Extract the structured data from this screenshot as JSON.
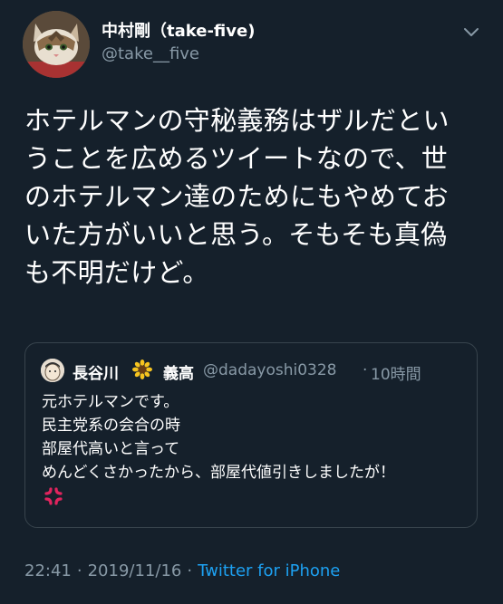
{
  "author": {
    "display_name": "中村剛（take-five)",
    "handle": "@take__five",
    "avatar_icon": "cat-avatar-icon"
  },
  "menu_icon": "chevron-down-icon",
  "tweet_text": [
    "ホテルマンの守秘義務はザルだとい",
    "うことを広めるツイートなので、世",
    "のホテルマン達のためにもやめてお",
    "いた方がいいと思う。そもそも真偽",
    "も不明だけど。"
  ],
  "quoted_tweet": {
    "name_part1": "長谷川",
    "name_icon": "sunflower-icon",
    "name_part2": "義高",
    "handle": "@dadayoshi0328",
    "separator": "·",
    "time": "10時間",
    "text": [
      "元ホテルマンです。",
      "民主党系の会合の時",
      "部屋代高いと言って",
      "めんどくさかったから、部屋代値引きしましたが！"
    ],
    "emoji_icon": "anger-symbol-icon"
  },
  "meta": {
    "time": "22:41",
    "separator": "·",
    "date": "2019/11/16",
    "source": "Twitter for iPhone"
  },
  "colors": {
    "background": "#15202b",
    "secondary_text": "#8899a6",
    "link": "#1da1f2",
    "border": "#38444d"
  }
}
